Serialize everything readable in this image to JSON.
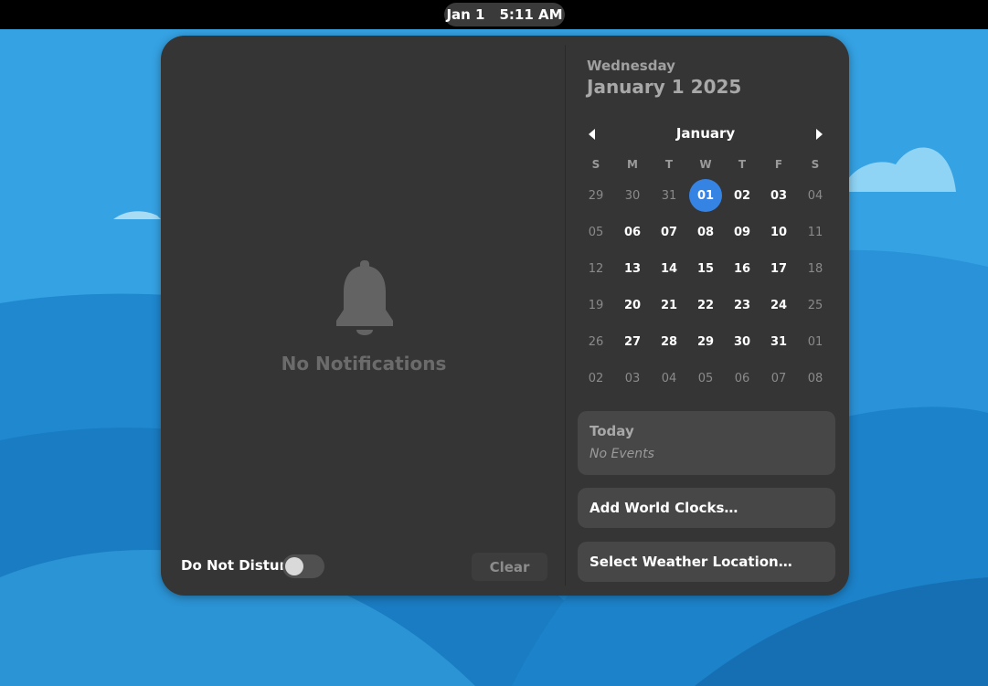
{
  "topbar": {
    "date": "Jan 1",
    "time": "5:11 AM"
  },
  "notifications": {
    "empty_text": "No Notifications",
    "dnd_label": "Do Not Disturb",
    "dnd_enabled": false,
    "clear_label": "Clear"
  },
  "calendar": {
    "weekday": "Wednesday",
    "full_date": "January 1 2025",
    "month": "January",
    "days_of_week": [
      "S",
      "M",
      "T",
      "W",
      "T",
      "F",
      "S"
    ],
    "weeks": [
      [
        {
          "d": "29",
          "o": 1
        },
        {
          "d": "30",
          "o": 1
        },
        {
          "d": "31",
          "o": 1
        },
        {
          "d": "01",
          "t": 1
        },
        {
          "d": "02"
        },
        {
          "d": "03"
        },
        {
          "d": "04",
          "w": 1
        }
      ],
      [
        {
          "d": "05",
          "w": 1
        },
        {
          "d": "06"
        },
        {
          "d": "07"
        },
        {
          "d": "08"
        },
        {
          "d": "09"
        },
        {
          "d": "10"
        },
        {
          "d": "11",
          "w": 1
        }
      ],
      [
        {
          "d": "12",
          "w": 1
        },
        {
          "d": "13"
        },
        {
          "d": "14"
        },
        {
          "d": "15"
        },
        {
          "d": "16"
        },
        {
          "d": "17"
        },
        {
          "d": "18",
          "w": 1
        }
      ],
      [
        {
          "d": "19",
          "w": 1
        },
        {
          "d": "20"
        },
        {
          "d": "21"
        },
        {
          "d": "22"
        },
        {
          "d": "23"
        },
        {
          "d": "24"
        },
        {
          "d": "25",
          "w": 1
        }
      ],
      [
        {
          "d": "26",
          "w": 1
        },
        {
          "d": "27"
        },
        {
          "d": "28"
        },
        {
          "d": "29"
        },
        {
          "d": "30"
        },
        {
          "d": "31"
        },
        {
          "d": "01",
          "o": 1
        }
      ],
      [
        {
          "d": "02",
          "o": 1
        },
        {
          "d": "03",
          "o": 1
        },
        {
          "d": "04",
          "o": 1
        },
        {
          "d": "05",
          "o": 1
        },
        {
          "d": "06",
          "o": 1
        },
        {
          "d": "07",
          "o": 1
        },
        {
          "d": "08",
          "o": 1
        }
      ]
    ]
  },
  "events": {
    "title": "Today",
    "empty_text": "No Events"
  },
  "world_clocks": {
    "label": "Add World Clocks…"
  },
  "weather": {
    "label": "Select Weather Location…"
  },
  "colors": {
    "accent": "#3584e4",
    "popover_bg": "#353535",
    "card_bg": "#474747"
  }
}
